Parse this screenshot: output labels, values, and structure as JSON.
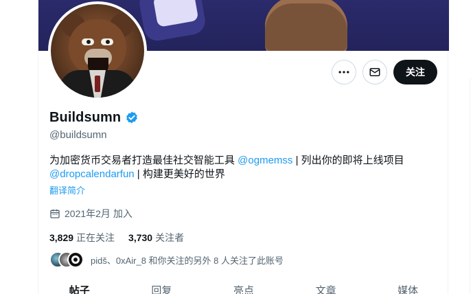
{
  "profile": {
    "display_name": "Buildsumn",
    "handle": "@buildsumn",
    "verified": true,
    "bio": {
      "part1": "为加密货币交易者打造最佳社交智能工具 ",
      "mention1": "@ogmemss",
      "part2": " | 列出你的即将上线项目",
      "mention2": "@dropcalendarfun",
      "part3": " | 构建更美好的世界"
    },
    "translate_label": "翻译简介",
    "joined": "2021年2月 加入",
    "following_count": "3,829",
    "following_label": "正在关注",
    "followers_count": "3,730",
    "followers_label": "关注者",
    "mutuals_text": "pidš、0xAir_8 和你关注的另外 8 人关注了此账号"
  },
  "actions": {
    "more_icon": "more-horizontal-icon",
    "message_icon": "envelope-icon",
    "follow_label": "关注"
  },
  "tabs": [
    {
      "label": "帖子",
      "active": true
    },
    {
      "label": "回复",
      "active": false
    },
    {
      "label": "亮点",
      "active": false
    },
    {
      "label": "文章",
      "active": false
    },
    {
      "label": "媒体",
      "active": false
    }
  ],
  "colors": {
    "accent": "#1d9bf0",
    "text_primary": "#0f1419",
    "text_secondary": "#536471",
    "banner": "#2b2a6b",
    "follow_button": "#0f1419"
  }
}
